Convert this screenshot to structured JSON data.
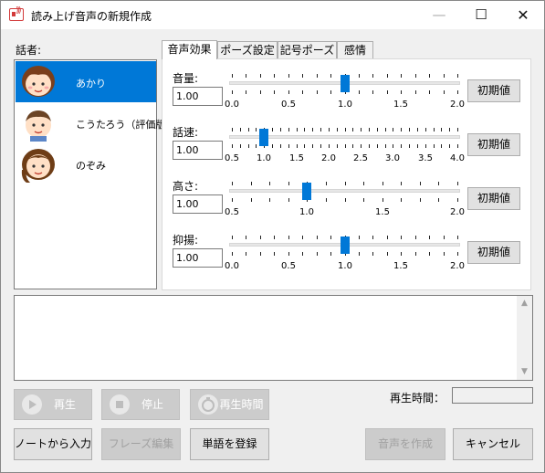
{
  "window": {
    "title": "読み上げ音声の新規作成",
    "minimize": "—",
    "maximize": "☐",
    "close": "✕"
  },
  "speakers": {
    "label": "話者:",
    "items": [
      {
        "name": "あかり",
        "selected": true
      },
      {
        "name": "こうたろう（評価版）",
        "selected": false
      },
      {
        "name": "のぞみ",
        "selected": false
      }
    ]
  },
  "tabs": [
    {
      "label": "音声効果",
      "active": true
    },
    {
      "label": "ポーズ設定",
      "active": false
    },
    {
      "label": "記号ポーズ",
      "active": false
    },
    {
      "label": "感情",
      "active": false
    }
  ],
  "params": [
    {
      "label": "音量:",
      "value": "1.00",
      "ticks": [
        "0.0",
        "0.5",
        "1.0",
        "1.5",
        "2.0"
      ],
      "min": 0,
      "max": 2,
      "current": 1.0,
      "reset": "初期値"
    },
    {
      "label": "話速:",
      "value": "1.00",
      "ticks": [
        "0.5",
        "1.0",
        "1.5",
        "2.0",
        "2.5",
        "3.0",
        "3.5",
        "4.0"
      ],
      "min": 0.5,
      "max": 4,
      "current": 1.0,
      "reset": "初期値"
    },
    {
      "label": "高さ:",
      "value": "1.00",
      "ticks": [
        "0.5",
        "1.0",
        "1.5",
        "2.0"
      ],
      "min": 0.5,
      "max": 2,
      "current": 1.0,
      "reset": "初期値"
    },
    {
      "label": "抑揚:",
      "value": "1.00",
      "ticks": [
        "0.0",
        "0.5",
        "1.0",
        "1.5",
        "2.0"
      ],
      "min": 0,
      "max": 2,
      "current": 1.0,
      "reset": "初期値"
    }
  ],
  "controls": {
    "play": "再生",
    "stop": "停止",
    "duration": "再生時間"
  },
  "playtime_label": "再生時間：",
  "bottom": {
    "from_note": "ノートから入力",
    "phrase_edit": "フレーズ編集",
    "register_word": "単語を登録",
    "create_voice": "音声を作成",
    "cancel": "キャンセル"
  },
  "colors": {
    "accent": "#0078d7",
    "icon": "#d23a3a"
  },
  "icons": {
    "app": "speaker-icon",
    "play": "play-icon",
    "stop": "stop-icon",
    "duration": "timer-icon"
  }
}
